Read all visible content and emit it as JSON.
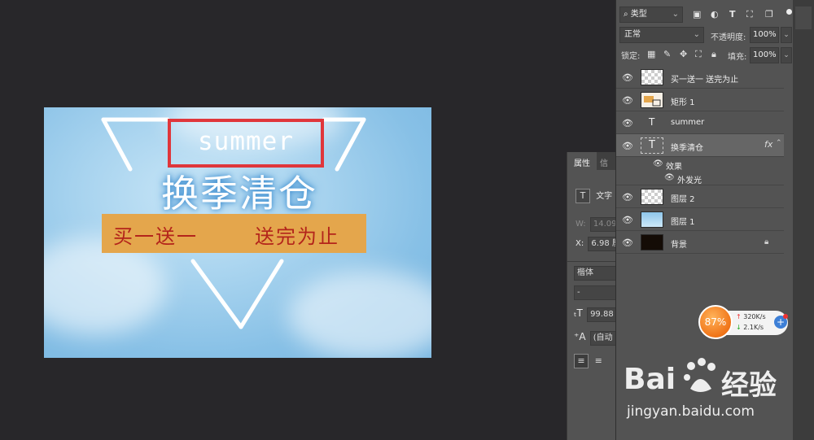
{
  "artwork": {
    "summer": "summer",
    "title": "换季清仓",
    "banner_left": "买一送一",
    "banner_right": "送完为止"
  },
  "properties_panel": {
    "tab_properties": "属性",
    "tab_info": "信",
    "type_label": "文字",
    "w_label": "W:",
    "w_value": "14.09",
    "x_label": "X:",
    "x_value": "6.98 厘",
    "font_family": "楷体",
    "font_style": "-",
    "size_value": "99.88",
    "leading_value": "(自动"
  },
  "layers_panel": {
    "filter_label": "类型",
    "blend_mode": "正常",
    "opacity_label": "不透明度:",
    "opacity_value": "100%",
    "lock_label": "锁定:",
    "fill_label": "填充:",
    "fill_value": "100%",
    "layers": [
      {
        "name": "买一送一   送完为止"
      },
      {
        "name": "矩形 1"
      },
      {
        "name": "summer"
      },
      {
        "name": "换季清仓",
        "fx": "fx"
      },
      {
        "name": "图层 2"
      },
      {
        "name": "图层 1"
      },
      {
        "name": "背景"
      }
    ],
    "effects_label": "效果",
    "outer_glow_label": "外发光"
  },
  "speed_widget": {
    "percent": "87%",
    "upload": "320K/s",
    "download": "2.1K/s"
  },
  "watermark": {
    "brand_left": "Bai",
    "brand_right": "经验",
    "url": "jingyan.baidu.com"
  }
}
